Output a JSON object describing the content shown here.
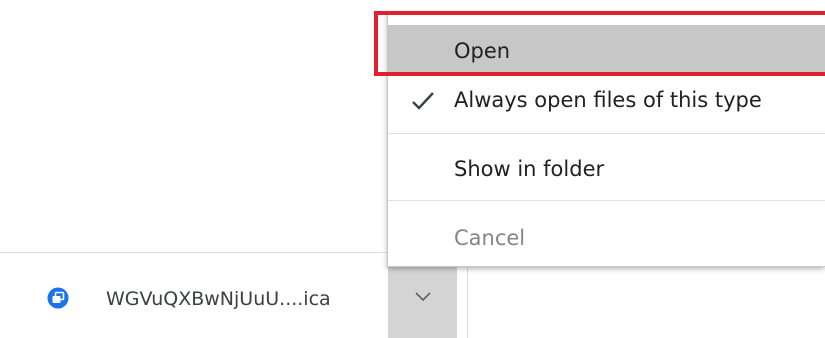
{
  "download_shelf": {
    "file_name": "WGVuQXBwNjUuU....ica",
    "file_icon": "citrix-receiver-icon",
    "caret_icon": "chevron-down-icon"
  },
  "context_menu": {
    "items": [
      {
        "label": "Open",
        "highlighted": true
      },
      {
        "label": "Always open files of this type",
        "checked": true,
        "icon": "check-icon"
      },
      {
        "label": "Show in folder"
      },
      {
        "label": "Cancel"
      }
    ]
  },
  "colors": {
    "highlight_box": "#e0202e",
    "selected_item": "#c7c7c7",
    "file_icon": "#1a73e8"
  }
}
